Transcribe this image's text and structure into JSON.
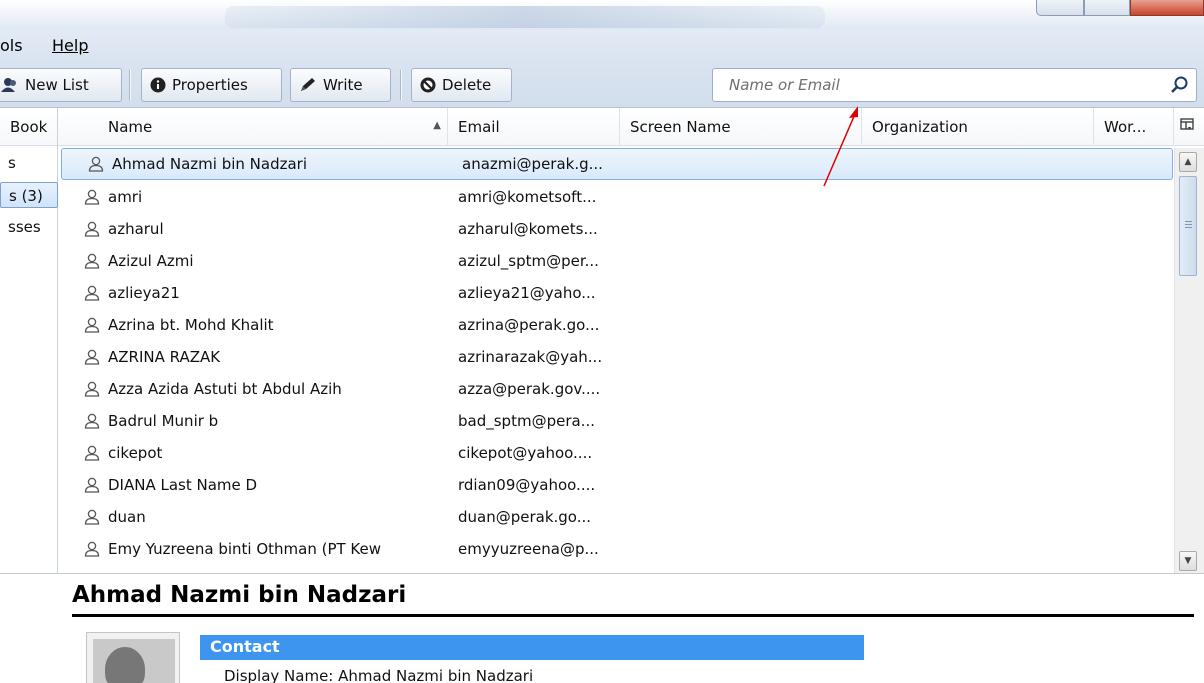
{
  "colors": {
    "accent": "#3d95f0",
    "selection_border": "#84acdd",
    "annotation": "#e00000"
  },
  "menubar": {
    "items": [
      "ols",
      "Help"
    ]
  },
  "toolbar": {
    "new_list": "New List",
    "properties": "Properties",
    "write": "Write",
    "delete": "Delete"
  },
  "search": {
    "placeholder": "Name or Email"
  },
  "sidebar": {
    "header": "Book",
    "items": [
      "s",
      "s (3)",
      "sses"
    ]
  },
  "table": {
    "columns": [
      "Name",
      "Email",
      "Screen Name",
      "Organization",
      "Wor..."
    ],
    "rows": [
      {
        "name": "Ahmad Nazmi bin Nadzari",
        "email": "anazmi@perak.g..."
      },
      {
        "name": "amri",
        "email": "amri@kometsoft..."
      },
      {
        "name": "azharul",
        "email": "azharul@komets..."
      },
      {
        "name": "Azizul Azmi",
        "email": "azizul_sptm@per..."
      },
      {
        "name": "azlieya21",
        "email": "azlieya21@yaho..."
      },
      {
        "name": "Azrina bt. Mohd Khalit",
        "email": "azrina@perak.go..."
      },
      {
        "name": "AZRINA RAZAK",
        "email": "azrinarazak@yah..."
      },
      {
        "name": "Azza Azida Astuti bt Abdul Azih",
        "email": "azza@perak.gov...."
      },
      {
        "name": "Badrul Munir b",
        "email": "bad_sptm@pera..."
      },
      {
        "name": "cikepot",
        "email": "cikepot@yahoo...."
      },
      {
        "name": "DIANA Last Name D",
        "email": "rdian09@yahoo...."
      },
      {
        "name": "duan",
        "email": "duan@perak.go..."
      },
      {
        "name": "Emy Yuzreena binti Othman (PT Kew",
        "email": "emyyuzreena@p..."
      }
    ]
  },
  "detail": {
    "title": "Ahmad Nazmi bin Nadzari",
    "section": "Contact",
    "display_name": "Display Name: Ahmad Nazmi bin Nadzari"
  }
}
